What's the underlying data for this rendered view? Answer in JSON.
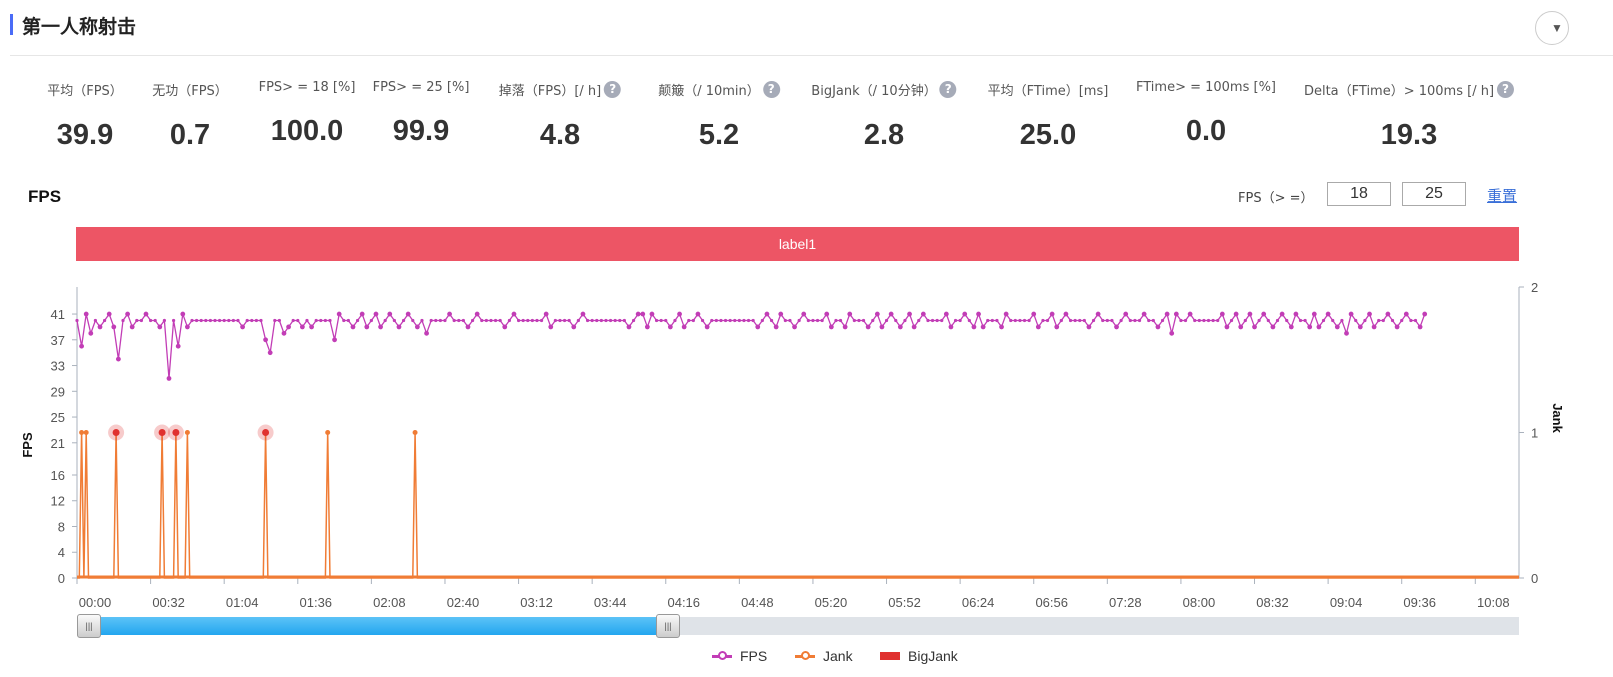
{
  "header": {
    "title": "第一人称射击",
    "collapse_icon": "chevron-down-icon"
  },
  "metrics": [
    {
      "label": "平均（FPS）",
      "value": "39.9",
      "help": false
    },
    {
      "label": "无功（FPS）",
      "value": "0.7",
      "help": false
    },
    {
      "label": "FPS> = 18 [%]",
      "value": "100.0",
      "help": false
    },
    {
      "label": "FPS> = 25 [%]",
      "value": "99.9",
      "help": false
    },
    {
      "label": "掉落（FPS）[/ h]",
      "value": "4.8",
      "help": true
    },
    {
      "label": "颠簸（/ 10min）",
      "value": "5.2",
      "help": true
    },
    {
      "label": "BigJank（/ 10分钟）",
      "value": "2.8",
      "help": true
    },
    {
      "label": "平均（FTime）[ms]",
      "value": "25.0",
      "help": false
    },
    {
      "label": "FTime> = 100ms [%]",
      "value": "0.0",
      "help": false
    },
    {
      "label": "Delta（FTime）> 100ms [/ h]",
      "value": "19.3",
      "help": true
    }
  ],
  "chart_section": {
    "title": "FPS",
    "threshold_label": "FPS（> =）",
    "threshold_low": "18",
    "threshold_high": "25",
    "reset_label": "重置",
    "band_label": "label1",
    "band_color": "#ed5565"
  },
  "chart_data": {
    "type": "line",
    "xlabel": "",
    "ylabel_left": "FPS",
    "ylabel_right": "Jank",
    "x_unit": "seconds",
    "xlim": [
      0,
      627
    ],
    "x_tick_labels": [
      "00:00",
      "00:32",
      "01:04",
      "01:36",
      "02:08",
      "02:40",
      "03:12",
      "03:44",
      "04:16",
      "04:48",
      "05:20",
      "05:52",
      "06:24",
      "06:56",
      "07:28",
      "08:00",
      "08:32",
      "09:04",
      "09:36",
      "10:08"
    ],
    "y_left_ticks": [
      0,
      4,
      8,
      12,
      16,
      21,
      25,
      29,
      33,
      37,
      41
    ],
    "y_left_lim": [
      0,
      45.2
    ],
    "y_right_ticks": [
      0,
      1,
      2
    ],
    "y_right_lim": [
      0,
      2
    ],
    "grid": false,
    "legend_placement": "bottom",
    "fps_sample_interval_s": 2,
    "series": [
      {
        "name": "FPS",
        "color": "#c23db6",
        "axis": "left",
        "values": [
          40,
          36,
          41,
          38,
          40,
          39,
          40,
          41,
          39,
          34,
          40,
          41,
          39,
          40,
          40,
          41,
          40,
          40,
          39,
          40,
          31,
          40,
          36,
          41,
          39,
          40,
          40,
          40,
          40,
          40,
          40,
          40,
          40,
          40,
          40,
          40,
          39,
          40,
          40,
          40,
          40,
          37,
          35,
          40,
          40,
          38,
          39,
          40,
          40,
          39,
          40,
          39,
          40,
          40,
          40,
          40,
          37,
          41,
          40,
          40,
          39,
          40,
          41,
          39,
          40,
          41,
          39,
          40,
          41,
          40,
          39,
          40,
          41,
          40,
          39,
          40,
          38,
          40,
          40,
          40,
          40,
          41,
          40,
          40,
          40,
          39,
          40,
          41,
          40,
          40,
          40,
          40,
          40,
          39,
          40,
          41,
          40,
          40,
          40,
          40,
          40,
          40,
          41,
          39,
          40,
          40,
          40,
          40,
          39,
          40,
          41,
          40,
          40,
          40,
          40,
          40,
          40,
          40,
          40,
          40,
          39,
          40,
          41,
          41,
          39,
          41,
          40,
          40,
          40,
          39,
          40,
          41,
          39,
          40,
          40,
          41,
          40,
          39,
          40,
          40,
          40,
          40,
          40,
          40,
          40,
          40,
          40,
          40,
          39,
          40,
          41,
          40,
          39,
          41,
          40,
          40,
          39,
          40,
          41,
          40,
          40,
          40,
          40,
          41,
          39,
          40,
          40,
          39,
          41,
          40,
          40,
          40,
          39,
          40,
          41,
          39,
          40,
          41,
          40,
          39,
          40,
          41,
          39,
          40,
          41,
          40,
          40,
          40,
          40,
          41,
          39,
          40,
          40,
          41,
          40,
          39,
          41,
          39,
          40,
          40,
          40,
          39,
          41,
          40,
          40,
          40,
          40,
          40,
          41,
          39,
          40,
          40,
          41,
          39,
          40,
          41,
          40,
          40,
          40,
          40,
          39,
          40,
          41,
          40,
          40,
          40,
          39,
          40,
          41,
          40,
          40,
          40,
          41,
          40,
          40,
          39,
          40,
          41,
          38,
          41,
          40,
          40,
          41,
          40,
          40,
          40,
          40,
          40,
          40,
          41,
          39,
          40,
          41,
          39,
          40,
          41,
          39,
          40,
          41,
          40,
          39,
          40,
          41,
          40,
          39,
          41,
          40,
          40,
          39,
          41,
          39,
          40,
          41,
          40,
          39,
          40,
          38,
          41,
          40,
          39,
          40,
          41,
          39,
          40,
          40,
          41,
          40,
          39,
          40,
          41,
          40,
          40,
          39,
          41
        ]
      },
      {
        "name": "Jank",
        "color": "#f07c35",
        "axis": "right",
        "event_times_s": [
          2,
          4,
          17,
          37,
          43,
          48,
          82,
          109,
          147
        ],
        "event_value": 1
      },
      {
        "name": "BigJank",
        "color": "#e0312f",
        "axis": "right",
        "event_times_s": [
          17,
          37,
          43,
          82
        ],
        "event_value": 1
      }
    ]
  },
  "slider": {
    "start_fraction": 0.0,
    "end_fraction": 0.41
  }
}
